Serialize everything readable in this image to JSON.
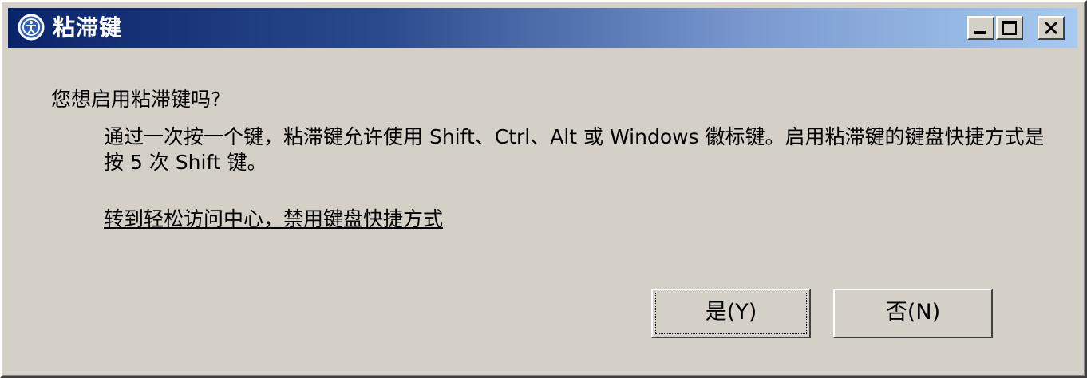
{
  "window": {
    "title": "粘滞键",
    "icon": "accessibility-icon",
    "controls": {
      "minimize": "minimize-icon",
      "maximize": "maximize-icon",
      "close": "close-icon"
    }
  },
  "dialog": {
    "question": "您想启用粘滞键吗?",
    "description": "通过一次按一个键，粘滞键允许使用 Shift、Ctrl、Alt 或 Windows 徽标键。启用粘滞键的键盘快捷方式是按 5 次 Shift 键。",
    "link": "转到轻松访问中心，禁用键盘快捷方式"
  },
  "buttons": {
    "yes": "是(Y)",
    "no": "否(N)"
  },
  "colors": {
    "titlebar_start": "#0a246a",
    "titlebar_end": "#a6caf0",
    "face": "#d4d0c8"
  }
}
